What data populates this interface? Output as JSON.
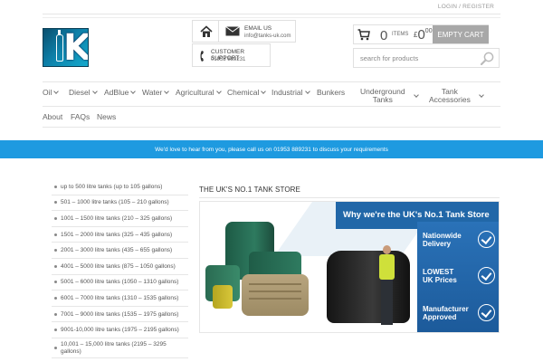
{
  "header": {
    "top_link": "LOGIN / REGISTER",
    "email_label": "EMAIL US",
    "email_value": "info@tanks-uk.com",
    "support_label": "CUSTOMER SUPPORT",
    "support_value": "01953 889231"
  },
  "cart": {
    "count": "0",
    "items_label": "ITEMS",
    "currency": "£",
    "total": "0",
    "total_decimals": "00",
    "empty_label": "EMPTY CART"
  },
  "search": {
    "placeholder": "search for products"
  },
  "nav": {
    "oil": "Oil",
    "diesel": "Diesel",
    "adblue": "AdBlue",
    "water": "Water",
    "agricultural": "Agricultural",
    "chemical": "Chemical",
    "industrial": "Industrial",
    "bunkers": "Bunkers",
    "underground_1": "Underground",
    "underground_2": "Tanks",
    "tank_acc_1": "Tank",
    "tank_acc_2": "Accessories",
    "about": "About",
    "faqs": "FAQs",
    "news": "News"
  },
  "banner": {
    "text": "We'd love to hear from you, please call us on 01953 889231 to discuss your requirements"
  },
  "categories": [
    "up to 500 litre tanks (up to 105 gallons)",
    "501 – 1000 litre tanks (105 – 210 gallons)",
    "1001 – 1500 litre tanks (210 – 325 gallons)",
    "1501 – 2000 litre tanks (325 – 435 gallons)",
    "2001 – 3000 litre tanks (435 – 655 gallons)",
    "4001 – 5000 litre tanks (875 – 1050 gallons)",
    "5001 – 6000 litre tanks (1050 – 1310 gallons)",
    "6001 – 7000 litre tanks (1310 – 1535 gallons)",
    "7001 – 9000 litre tanks (1535 – 1975 gallons)",
    "9001-10,000 litre tanks (1975 – 2195 gallons)",
    "10,001 – 15,000 litre tanks (2195 – 3295 gallons)"
  ],
  "store": {
    "title": "THE UK'S No.1 TANK STORE",
    "hero_headline": "Why we're the UK's No.1 Tank Store",
    "badges": [
      [
        "Nationwide",
        "Delivery"
      ],
      [
        "LOWEST",
        "UK Prices"
      ],
      [
        "Manufacturer",
        "Approved"
      ]
    ]
  },
  "colors": {
    "banner": "#1e9ae0",
    "hero_blue": "#2167a8",
    "empty_cart_bg": "#a8a8a8"
  }
}
